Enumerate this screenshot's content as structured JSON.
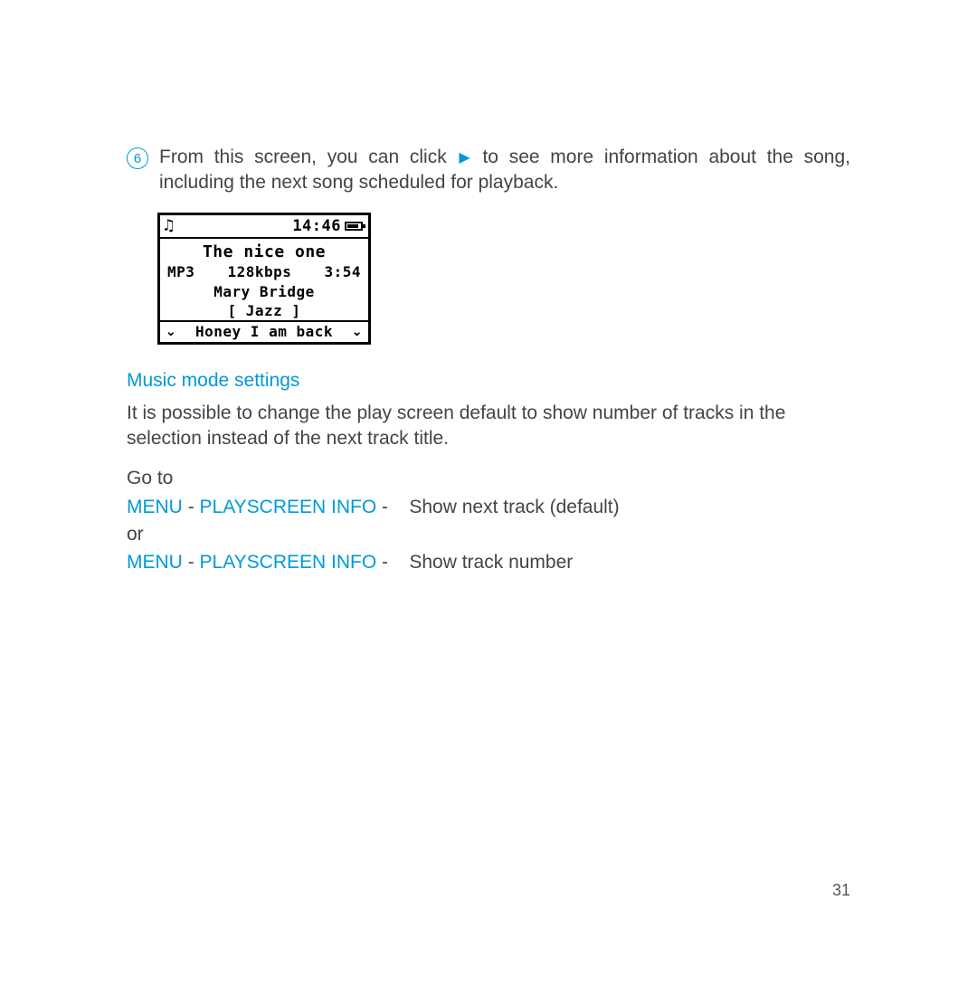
{
  "step": {
    "number": "6",
    "text_before_icon": "From this screen, you can click ",
    "text_after_icon": " to see more information about the song, including the next song scheduled for playback."
  },
  "device": {
    "time": "14:46",
    "title": "The  nice  one",
    "format": "MP3",
    "bitrate": "128kbps",
    "duration": "3:54",
    "artist": "Mary Bridge",
    "genre": "[ Jazz ]",
    "next_track": "Honey I am back"
  },
  "section_heading": "Music mode settings",
  "para1": "It is possible to change the play screen default to show number of tracks in the selection instead of the next track title.",
  "goto_label": "Go to",
  "menu_label": "MENU",
  "playscreen_label": "PLAYSCREEN INFO",
  "opt_default": "Show next track (default)",
  "or_label": "or",
  "opt_number": "Show track number",
  "page_number": "31"
}
